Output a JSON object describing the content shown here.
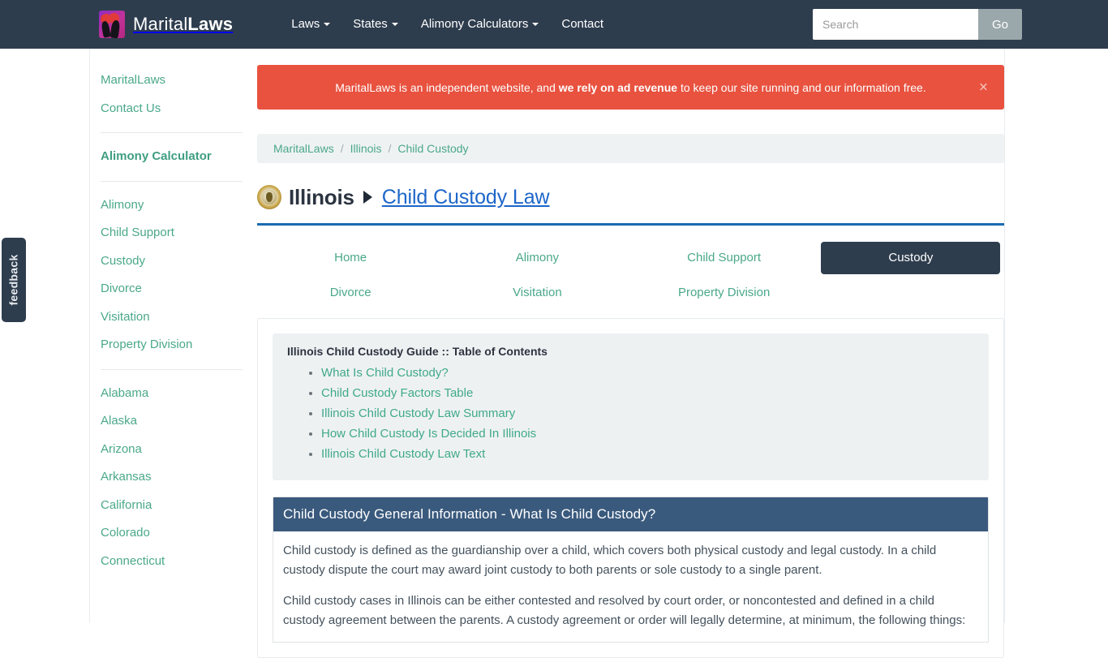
{
  "navbar": {
    "brand_primary": "Marital",
    "brand_secondary": "Laws",
    "links": [
      {
        "label": "Laws",
        "has_caret": true
      },
      {
        "label": "States",
        "has_caret": true
      },
      {
        "label": "Alimony Calculators",
        "has_caret": true
      },
      {
        "label": "Contact",
        "has_caret": false
      }
    ],
    "search_placeholder": "Search",
    "search_value": "",
    "search_button": "Go"
  },
  "feedback": {
    "label": "feedback"
  },
  "sidebar": {
    "top_links": [
      "MaritalLaws",
      "Contact Us"
    ],
    "calculator_link": "Alimony Calculator",
    "topic_links": [
      "Alimony",
      "Child Support",
      "Custody",
      "Divorce",
      "Visitation",
      "Property Division"
    ],
    "state_links": [
      "Alabama",
      "Alaska",
      "Arizona",
      "Arkansas",
      "California",
      "Colorado",
      "Connecticut"
    ]
  },
  "alert": {
    "text_before": "MaritalLaws is an independent website, and ",
    "text_strong": "we rely on ad revenue",
    "text_after": " to keep our site running and our information free.",
    "close_icon": "×"
  },
  "breadcrumb": {
    "items": [
      "MaritalLaws",
      "Illinois",
      "Child Custody"
    ],
    "separator": "/"
  },
  "title": {
    "seal_icon": "illinois-state-seal",
    "state": "Illinois",
    "arrow_icon": "triangle-right-icon",
    "topic": "Child Custody Law"
  },
  "tabs": [
    {
      "label": "Home",
      "active": false
    },
    {
      "label": "Alimony",
      "active": false
    },
    {
      "label": "Child Support",
      "active": false
    },
    {
      "label": "Custody",
      "active": true
    },
    {
      "label": "Divorce",
      "active": false
    },
    {
      "label": "Visitation",
      "active": false
    },
    {
      "label": "Property Division",
      "active": false
    }
  ],
  "toc": {
    "title": "Illinois Child Custody Guide :: Table of Contents",
    "items": [
      "What Is Child Custody?",
      "Child Custody Factors Table",
      "Illinois Child Custody Law Summary",
      "How Child Custody Is Decided In Illinois",
      "Illinois Child Custody Law Text"
    ]
  },
  "panel": {
    "heading": "Child Custody General Information - What Is Child Custody?",
    "paragraphs": [
      "Child custody is defined as the guardianship over a child, which covers both physical custody and legal custody. In a child custody dispute the court may award joint custody to both parents or sole custody to a single parent.",
      "Child custody cases in Illinois can be either contested and resolved by court order, or noncontested and defined in a child custody agreement between the parents. A custody agreement or order will legally determine, at minimum, the following things:"
    ]
  },
  "colors": {
    "navbar_bg": "#2e3d4e",
    "link_teal": "#4aa88a",
    "alert_red": "#e8523f",
    "title_blue": "#1d66c9",
    "rule_blue": "#1a6ab0",
    "panel_head": "#3a5a7d"
  }
}
